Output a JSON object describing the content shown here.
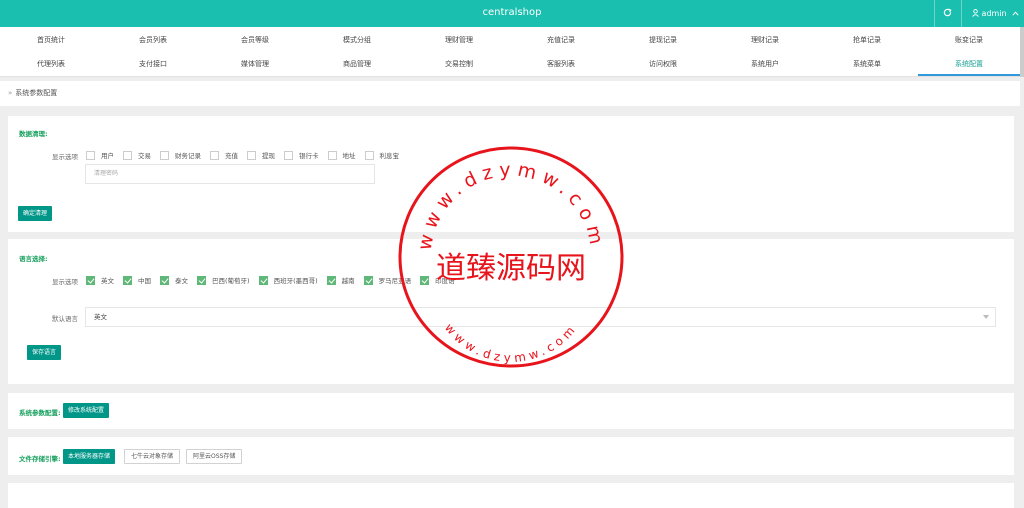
{
  "header": {
    "title": "centralshop",
    "user": "admin"
  },
  "nav": {
    "row1": [
      "首页统计",
      "会员列表",
      "会员等级",
      "模式分组",
      "理财管理",
      "充值记录",
      "提现记录",
      "理财记录",
      "抢单记录",
      "账变记录"
    ],
    "row2": [
      "代理列表",
      "支付接口",
      "媒体管理",
      "商品管理",
      "交易控制",
      "客服列表",
      "访问权限",
      "系统用户",
      "系统菜单",
      "系统配置"
    ],
    "active": "系统配置"
  },
  "breadcrumb": "系统参数配置",
  "data_clean": {
    "title": "数据清理:",
    "label": "显示选项",
    "options": [
      "用户",
      "交易",
      "财务记录",
      "充值",
      "提现",
      "银行卡",
      "地址",
      "利息宝"
    ],
    "password_placeholder": "清理密码",
    "button": "确定清理"
  },
  "language": {
    "title": "语言选择:",
    "label": "显示选项",
    "options": [
      "英文",
      "中国",
      "泰文",
      "巴西(葡萄牙)",
      "西班牙(墨西哥)",
      "越南",
      "罗马尼亚语",
      "印度语"
    ],
    "default_label": "默认语言",
    "default_value": "英文",
    "button": "保存语言"
  },
  "system": {
    "title": "系统参数配置:",
    "button": "修改系统配置"
  },
  "storage": {
    "title": "文件存储引擎:",
    "buttons": [
      "本地服务器存储",
      "七牛云对象存储",
      "阿里云OSS存储"
    ]
  },
  "watermark": {
    "url": "www.dzymw.com",
    "name": "道臻源码网",
    "color": "#e8141c"
  }
}
